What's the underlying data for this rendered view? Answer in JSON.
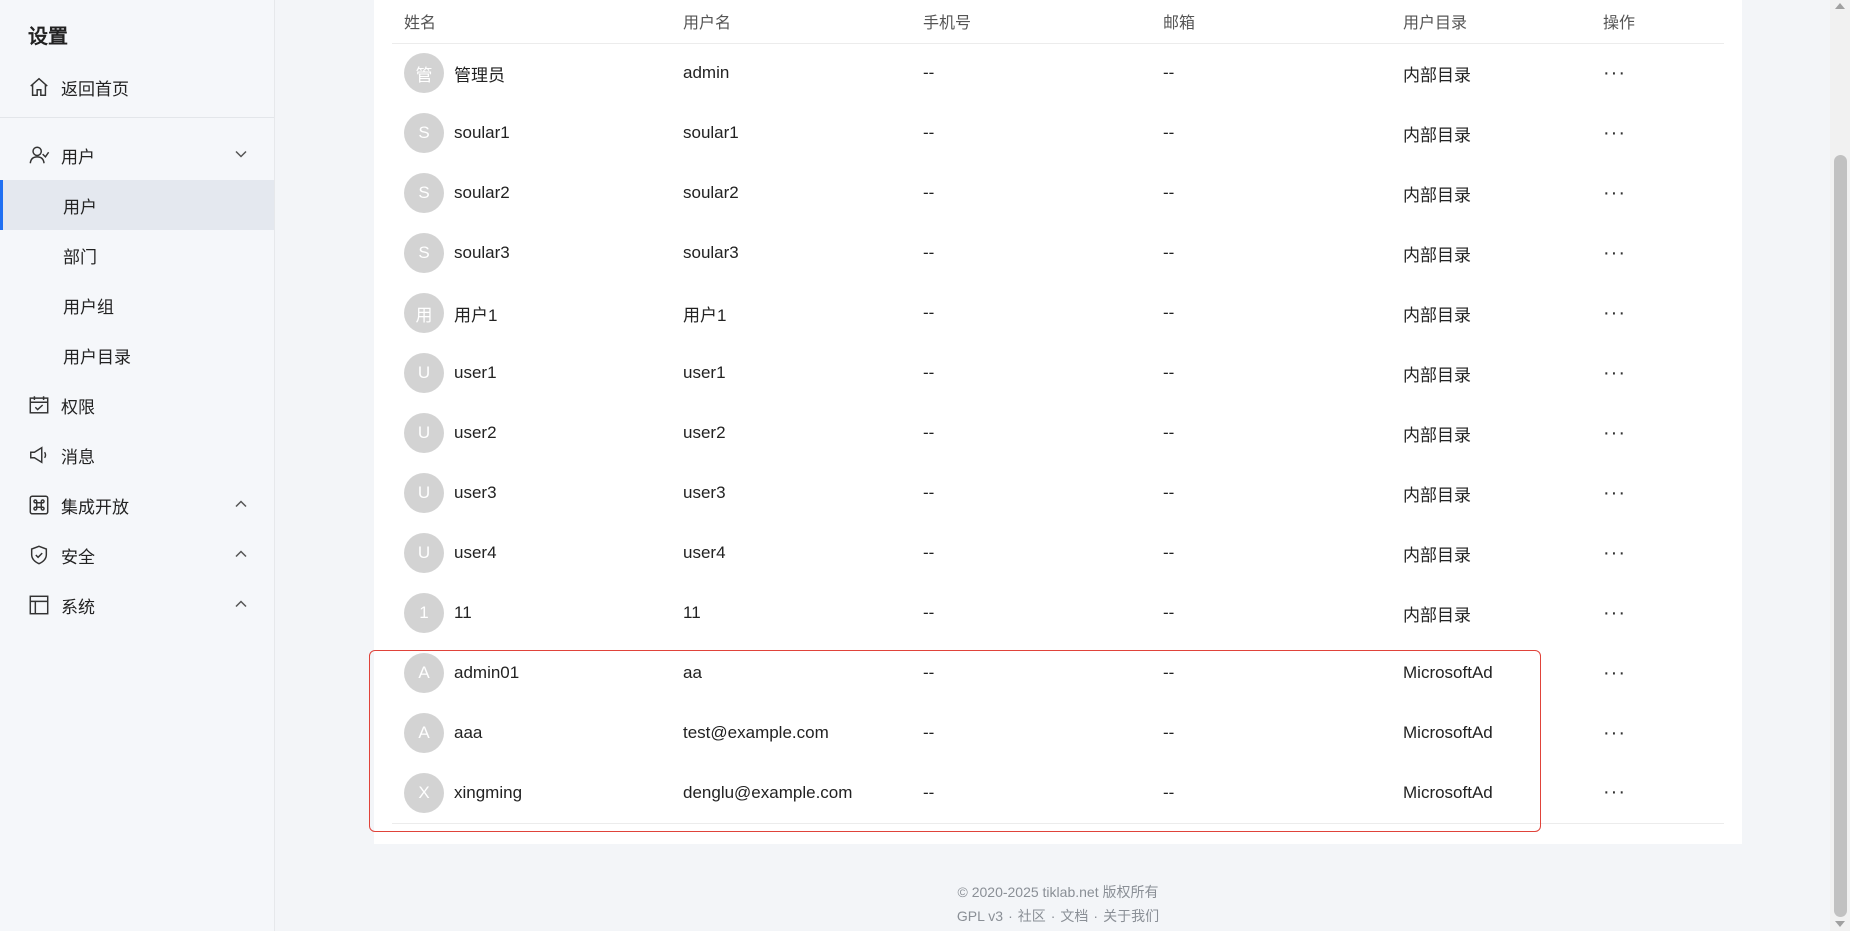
{
  "sidebar": {
    "title": "设置",
    "home_label": "返回首页",
    "groups": [
      {
        "label": "用户",
        "icon": "user-icon",
        "expanded": true
      },
      {
        "label": "权限",
        "icon": "calendar-check-icon"
      },
      {
        "label": "消息",
        "icon": "megaphone-icon"
      },
      {
        "label": "集成开放",
        "icon": "command-icon",
        "expanded": false
      },
      {
        "label": "安全",
        "icon": "shield-check-icon",
        "expanded": false
      },
      {
        "label": "系统",
        "icon": "layout-icon",
        "expanded": false
      }
    ],
    "user_subitems": [
      "用户",
      "部门",
      "用户组",
      "用户目录"
    ],
    "active_subitem": "用户"
  },
  "table": {
    "headers": [
      "姓名",
      "用户名",
      "手机号",
      "邮箱",
      "用户目录",
      "操作"
    ],
    "rows": [
      {
        "avatar": "管",
        "name": "管理员",
        "username": "admin",
        "phone": "--",
        "email": "--",
        "directory": "内部目录"
      },
      {
        "avatar": "S",
        "name": "soular1",
        "username": "soular1",
        "phone": "--",
        "email": "--",
        "directory": "内部目录"
      },
      {
        "avatar": "S",
        "name": "soular2",
        "username": "soular2",
        "phone": "--",
        "email": "--",
        "directory": "内部目录"
      },
      {
        "avatar": "S",
        "name": "soular3",
        "username": "soular3",
        "phone": "--",
        "email": "--",
        "directory": "内部目录"
      },
      {
        "avatar": "用",
        "name": "用户1",
        "username": "用户1",
        "phone": "--",
        "email": "--",
        "directory": "内部目录"
      },
      {
        "avatar": "U",
        "name": "user1",
        "username": "user1",
        "phone": "--",
        "email": "--",
        "directory": "内部目录"
      },
      {
        "avatar": "U",
        "name": "user2",
        "username": "user2",
        "phone": "--",
        "email": "--",
        "directory": "内部目录"
      },
      {
        "avatar": "U",
        "name": "user3",
        "username": "user3",
        "phone": "--",
        "email": "--",
        "directory": "内部目录"
      },
      {
        "avatar": "U",
        "name": "user4",
        "username": "user4",
        "phone": "--",
        "email": "--",
        "directory": "内部目录"
      },
      {
        "avatar": "1",
        "name": "11",
        "username": "11",
        "phone": "--",
        "email": "--",
        "directory": "内部目录"
      },
      {
        "avatar": "A",
        "name": "admin01",
        "username": "aa",
        "phone": "--",
        "email": "--",
        "directory": "MicrosoftAd"
      },
      {
        "avatar": "A",
        "name": "aaa",
        "username": "test@example.com",
        "phone": "--",
        "email": "--",
        "directory": "MicrosoftAd"
      },
      {
        "avatar": "X",
        "name": "xingming",
        "username": "denglu@example.com",
        "phone": "--",
        "email": "--",
        "directory": "MicrosoftAd"
      }
    ],
    "action_label": "···"
  },
  "footer": {
    "copyright": "© 2020-2025 tiklab.net 版权所有",
    "links": [
      "GPL v3",
      "社区",
      "文档",
      "关于我们"
    ]
  },
  "colors": {
    "accent": "#1f6ff2",
    "highlight_border": "#e0433a",
    "avatar_bg": "#d3d3d3"
  }
}
